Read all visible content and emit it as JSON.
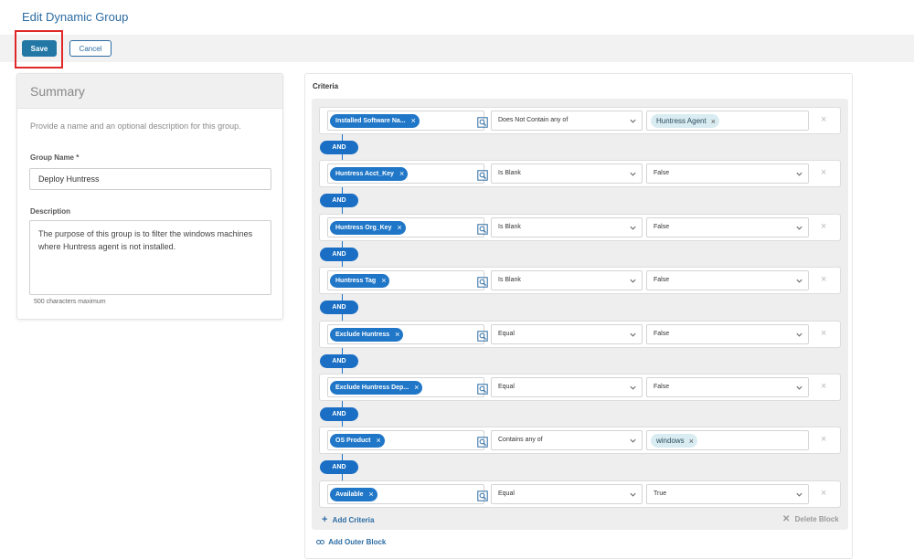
{
  "page_title": "Edit Dynamic Group",
  "toolbar": {
    "save_label": "Save",
    "cancel_label": "Cancel"
  },
  "summary": {
    "heading": "Summary",
    "description": "Provide a name and an optional description for this group.",
    "group_name_label": "Group Name *",
    "group_name_value": "Deploy Huntress",
    "description_label": "Description",
    "description_value": "The purpose of this group is to filter the windows machines where Huntress agent is not installed.",
    "char_limit": "500 characters maximum"
  },
  "criteria": {
    "title": "Criteria",
    "connector": "AND",
    "rows": [
      {
        "field": "Installed Software Na...",
        "operator": "Does Not Contain any of",
        "value": "Huntress Agent",
        "value_type": "chip"
      },
      {
        "field": "Huntress Acct_Key",
        "operator": "Is Blank",
        "value": "False",
        "value_type": "select"
      },
      {
        "field": "Huntress Org_Key",
        "operator": "Is Blank",
        "value": "False",
        "value_type": "select"
      },
      {
        "field": "Huntress Tag",
        "operator": "Is Blank",
        "value": "False",
        "value_type": "select"
      },
      {
        "field": "Exclude Huntress",
        "operator": "Equal",
        "value": "False",
        "value_type": "select"
      },
      {
        "field": "Exclude Huntress Dep...",
        "operator": "Equal",
        "value": "False",
        "value_type": "select"
      },
      {
        "field": "OS Product",
        "operator": "Contains any of",
        "value": "windows",
        "value_type": "chip"
      },
      {
        "field": "Available",
        "operator": "Equal",
        "value": "True",
        "value_type": "select"
      }
    ],
    "add_criteria_label": "Add Criteria",
    "delete_block_label": "Delete Block",
    "add_outer_block_label": "Add Outer Block"
  },
  "colors": {
    "primary": "#2277a5",
    "chip_blue": "#2077c8",
    "highlight_red": "#e02828"
  }
}
